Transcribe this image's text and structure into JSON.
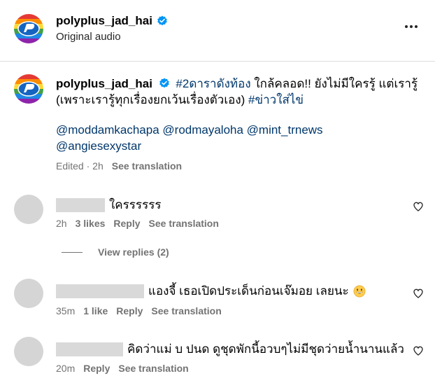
{
  "header": {
    "username": "polyplus_jad_hai",
    "subtitle": "Original audio"
  },
  "caption": {
    "username": "polyplus_jad_hai",
    "text_hashtag": "#2ดาราดังท้อง",
    "text_main": " ใกล้คลอด!! ยังไม่มีใครรู้ แต่เรารู้ (เพราะเรารู้ทุกเรื่องยกเว้นเรื่องตัวเอง) ",
    "text_hashtag2": "#ข่าวใส่ไข่",
    "mentions_line1": "@moddamkachapa @rodmayaloha @mint_trnews",
    "mentions_line2": "@angiesexystar",
    "meta_edited": "Edited",
    "meta_sep": "·",
    "meta_time": "2h",
    "meta_see_translation": "See translation"
  },
  "comments": [
    {
      "text": "ใครรรรรร",
      "time": "2h",
      "likes": "3 likes",
      "reply": "Reply",
      "see_translation": "See translation",
      "view_replies": "View replies (2)"
    },
    {
      "text": "แองจี้ เธอเปิดประเด็นก่อนเจ๊มอย เลยนะ",
      "time": "35m",
      "likes": "1 like",
      "reply": "Reply",
      "see_translation": "See translation"
    },
    {
      "text": "คิดว่าแม่ บ ปนด ดูชุดพักนี้อวบๆไม่มีชุดว่ายน้ำนานแล้ว",
      "time": "20m",
      "reply": "Reply",
      "see_translation": "See translation"
    }
  ],
  "icons": {
    "verified": "verified-badge-icon",
    "more": "more-options-icon",
    "heart": "heart-icon",
    "emoji": "grinning-face-emoji"
  },
  "colors": {
    "verified_blue": "#0095f6",
    "link_blue": "#00376b",
    "meta_gray": "#737373"
  }
}
